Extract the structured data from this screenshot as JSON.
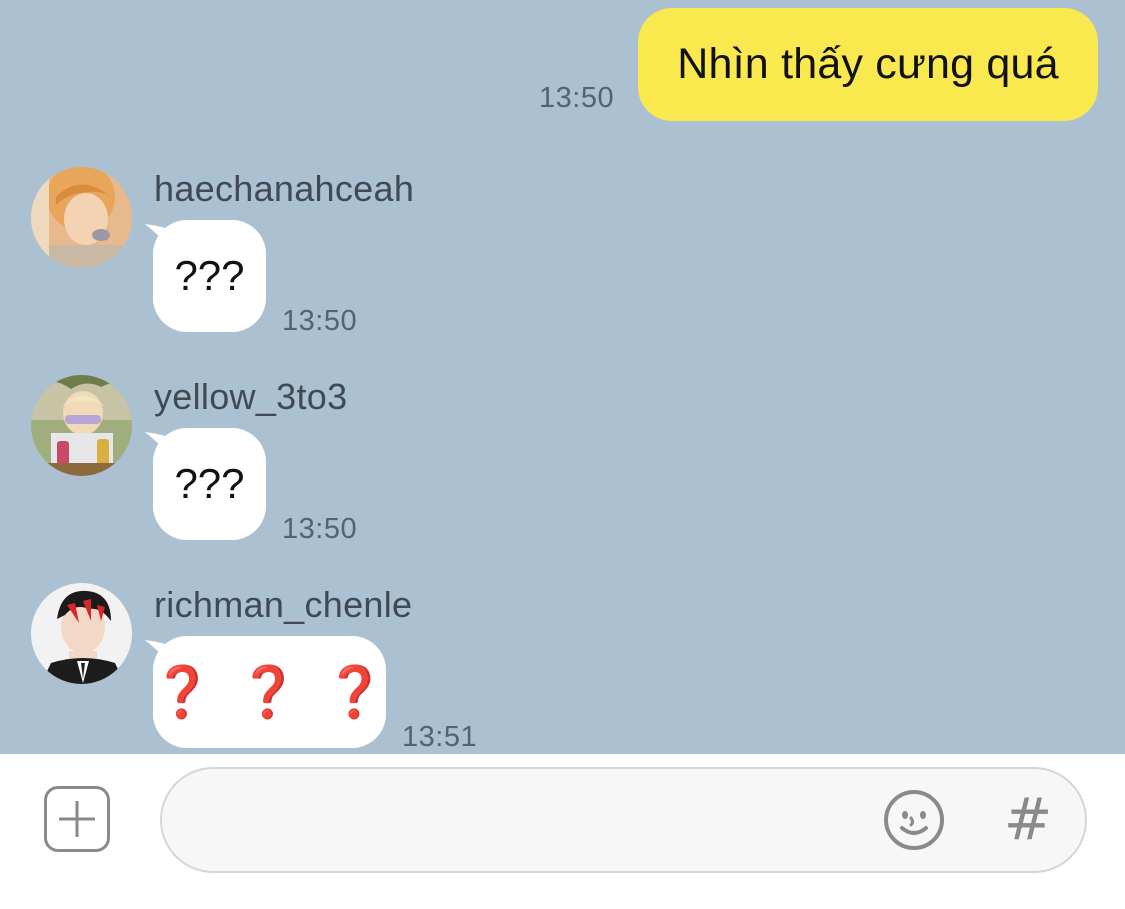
{
  "outgoing": {
    "text": "Nhìn thấy cưng quá",
    "time": "13:50"
  },
  "messages": [
    {
      "sender": "haechanahceah",
      "text": "???",
      "time": "13:50",
      "avatar": "avatar-haechan"
    },
    {
      "sender": "yellow_3to3",
      "text": "???",
      "time": "13:50",
      "avatar": "avatar-yellow"
    },
    {
      "sender": "richman_chenle",
      "text": "❓❓❓",
      "time": "13:51",
      "avatar": "avatar-chenle"
    }
  ],
  "composer": {
    "plus_icon": "plus-icon",
    "emoji_icon": "emoji-icon",
    "hash_label": "#"
  },
  "colors": {
    "chat_background": "#abc1d1",
    "outgoing_bubble": "#fae84f",
    "incoming_bubble": "#ffffff",
    "red_question": "#d0312d"
  }
}
